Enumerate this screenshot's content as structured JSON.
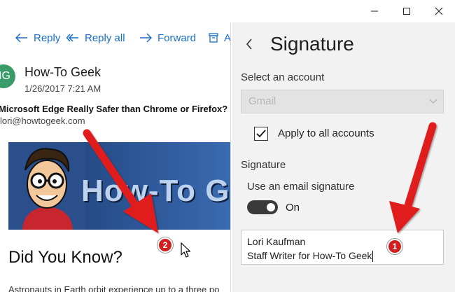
{
  "titlebar": {
    "minimize_icon": "minimize-icon",
    "maximize_icon": "maximize-icon",
    "close_icon": "close-icon"
  },
  "mail": {
    "toolbar": {
      "reply_label": "Reply",
      "reply_all_label": "Reply all",
      "forward_label": "Forward",
      "archive_label": "A"
    },
    "avatar_initials": "IG",
    "sender": "How-To Geek",
    "date": "1/26/2017 7:21 AM",
    "subject": "Microsoft Edge Really Safer than Chrome or Firefox?",
    "from": "lori@howtogeek.com",
    "banner_text": "How-To Geek",
    "heading": "Did You Know?",
    "body_preview": "Astronauts in Earth orbit experience up to a three po"
  },
  "settings": {
    "title": "Signature",
    "select_account_label": "Select an account",
    "account_value": "Gmail",
    "apply_all_label": "Apply to all accounts",
    "apply_all_checked": true,
    "signature_heading": "Signature",
    "use_signature_label": "Use an email signature",
    "toggle_state": "On",
    "signature_lines": [
      "Lori Kaufman",
      "Staff Writer for How-To Geek"
    ]
  },
  "annotations": {
    "badge_1": "1",
    "badge_2": "2",
    "arrow_color": "#e01b1b"
  },
  "colors": {
    "accent": "#1a6fc9",
    "settings_bg": "#f2f2f2",
    "toggle_on": "#3a3a3a"
  }
}
